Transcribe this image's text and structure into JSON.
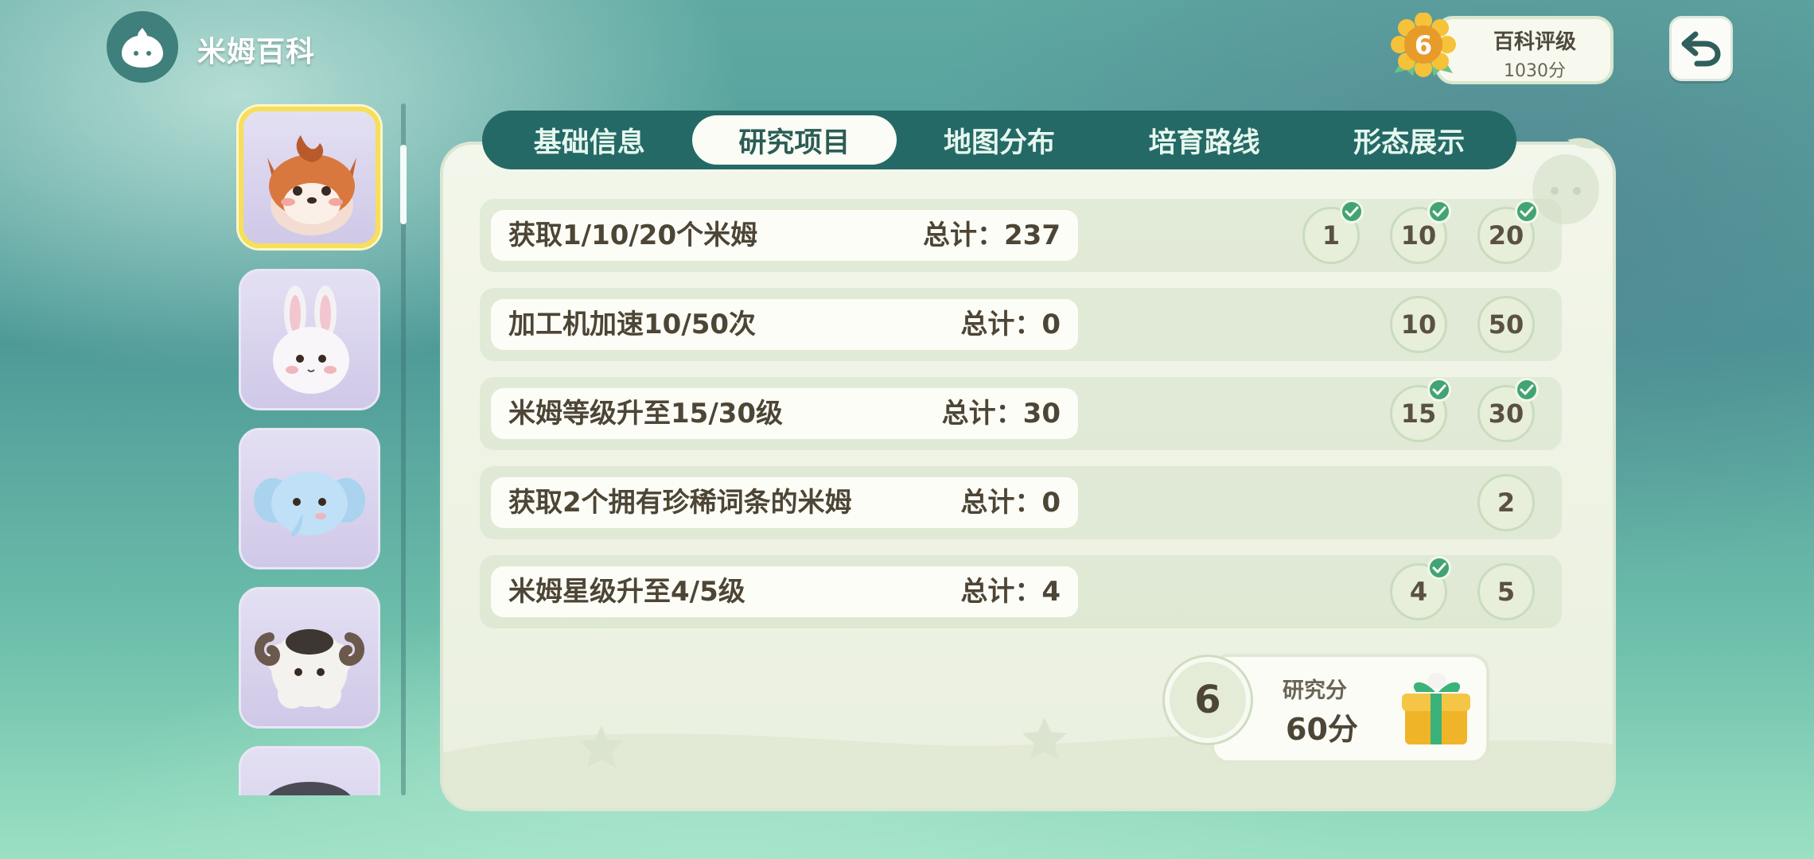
{
  "header": {
    "title": "米姆百科",
    "logo_icon": "slime-face-icon",
    "rating": {
      "level": "6",
      "title": "百科评级",
      "score": "1030分"
    },
    "back_icon": "back-arrow-icon"
  },
  "sidebar": {
    "slimes": [
      {
        "name": "fox-slime",
        "selected": true
      },
      {
        "name": "rabbit-slime",
        "selected": false
      },
      {
        "name": "elephant-slime",
        "selected": false
      },
      {
        "name": "sheep-slime",
        "selected": false
      },
      {
        "name": "dark-slime",
        "selected": false
      }
    ]
  },
  "tabs": [
    {
      "label": "基础信息",
      "active": false
    },
    {
      "label": "研究项目",
      "active": true
    },
    {
      "label": "地图分布",
      "active": false
    },
    {
      "label": "培育路线",
      "active": false
    },
    {
      "label": "形态展示",
      "active": false
    }
  ],
  "tasks": [
    {
      "name": "获取1/10/20个米姆",
      "total": "总计：237",
      "milestones": [
        {
          "value": "1",
          "done": true
        },
        {
          "value": "10",
          "done": true
        },
        {
          "value": "20",
          "done": true
        }
      ]
    },
    {
      "name": "加工机加速10/50次",
      "total": "总计：0",
      "milestones": [
        {
          "value": "10",
          "done": false
        },
        {
          "value": "50",
          "done": false
        }
      ]
    },
    {
      "name": "米姆等级升至15/30级",
      "total": "总计：30",
      "milestones": [
        {
          "value": "15",
          "done": true
        },
        {
          "value": "30",
          "done": true
        }
      ]
    },
    {
      "name": "获取2个拥有珍稀词条的米姆",
      "total": "总计：0",
      "milestones": [
        {
          "value": "2",
          "done": false
        }
      ]
    },
    {
      "name": "米姆星级升至4/5级",
      "total": "总计：4",
      "milestones": [
        {
          "value": "4",
          "done": true
        },
        {
          "value": "5",
          "done": false
        }
      ]
    }
  ],
  "research": {
    "level": "6",
    "label": "研究分",
    "score": "60分",
    "reward_icon": "gift-box-icon"
  },
  "colors": {
    "accent": "#246966",
    "check": "#43a473",
    "highlight": "#f6df5a"
  }
}
